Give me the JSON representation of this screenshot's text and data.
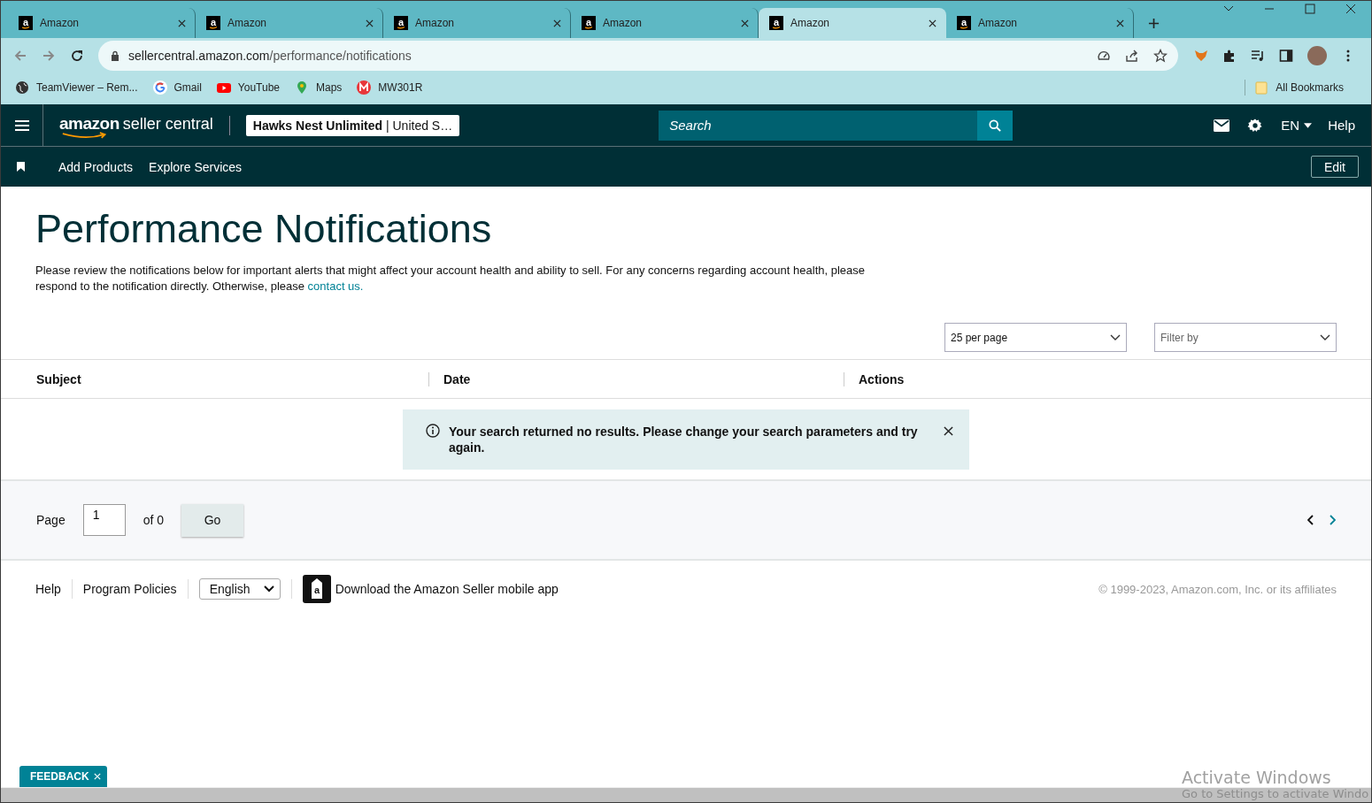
{
  "browser": {
    "tabs": [
      {
        "icon": "a",
        "title": "Amazon",
        "selected": false
      },
      {
        "icon": "a",
        "title": "Amazon",
        "selected": false
      },
      {
        "icon": "a",
        "title": "Amazon",
        "selected": false
      },
      {
        "icon": "a",
        "title": "Amazon",
        "selected": false
      },
      {
        "icon": "a",
        "title": "Amazon",
        "selected": true
      },
      {
        "icon": "a",
        "title": "Amazon",
        "selected": false
      }
    ],
    "address": {
      "host": "sellercentral.amazon.com",
      "path": "/performance/notifications"
    },
    "bookmarks": [
      {
        "kind": "globe",
        "label": "TeamViewer – Rem..."
      },
      {
        "kind": "google",
        "label": "Gmail"
      },
      {
        "kind": "youtube",
        "label": "YouTube"
      },
      {
        "kind": "maps",
        "label": "Maps"
      },
      {
        "kind": "m",
        "label": "MW301R"
      }
    ],
    "all_bookmarks": "All Bookmarks"
  },
  "header": {
    "logo_main": "amazon",
    "logo_sub": "seller central",
    "store": "**Hawks Nest Unlimited** | United S…",
    "search_placeholder": "Search",
    "language": "EN",
    "help": "Help"
  },
  "subnav": {
    "items": [
      "Add Products",
      "Explore Services"
    ],
    "edit": "Edit"
  },
  "page": {
    "title": "Performance Notifications",
    "description": "Please review the notifications below for important alerts that might affect your account health and ability to sell. For any concerns regarding account health, please respond to the notification directly. Otherwise, please ",
    "contact_link": "contact us.",
    "per_page": "25 per page",
    "filter_placeholder": "Filter by",
    "columns": [
      "Subject",
      "Date",
      "Actions"
    ],
    "alert": "Your search returned no results. Please change your search parameters and try again."
  },
  "pagination": {
    "label": "Page",
    "value": "1",
    "of": "of 0",
    "go": "Go"
  },
  "footer": {
    "links": [
      "Help",
      "Program Policies"
    ],
    "language": "English",
    "app_icon": "a",
    "app": "Download the Amazon Seller mobile app",
    "copyright": "© 1999-2023, Amazon.com, Inc. or its affiliates"
  },
  "feedback": "FEEDBACK",
  "os_overlay": {
    "title": "Activate Windows",
    "subtitle": "Go to Settings to activate Windo"
  }
}
